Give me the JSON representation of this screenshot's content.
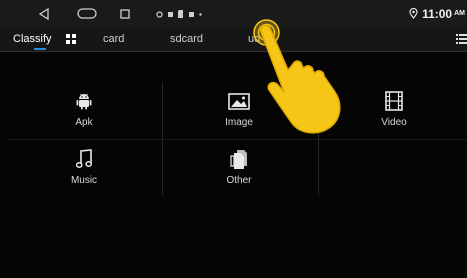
{
  "status_bar": {
    "icons": {
      "back": "back-triangle-icon",
      "home": "home-pill-icon",
      "recents": "recents-square-icon",
      "location": "location-pin-icon"
    },
    "time": "11:00",
    "ampm": "AM"
  },
  "tabs": [
    {
      "label": "Classify",
      "selected": true
    },
    {
      "label": "card",
      "selected": false
    },
    {
      "label": "sdcard",
      "selected": false
    },
    {
      "label": "ud",
      "selected": false
    }
  ],
  "categories": [
    {
      "label": "Apk",
      "icon": "android-icon"
    },
    {
      "label": "Image",
      "icon": "image-icon"
    },
    {
      "label": "Video",
      "icon": "film-icon"
    },
    {
      "label": "Music",
      "icon": "music-note-icon"
    },
    {
      "label": "Other",
      "icon": "document-icon"
    }
  ],
  "colors": {
    "background": "#050505",
    "tab_indicator": "#2a8ad8",
    "hand": "#f5c518"
  }
}
